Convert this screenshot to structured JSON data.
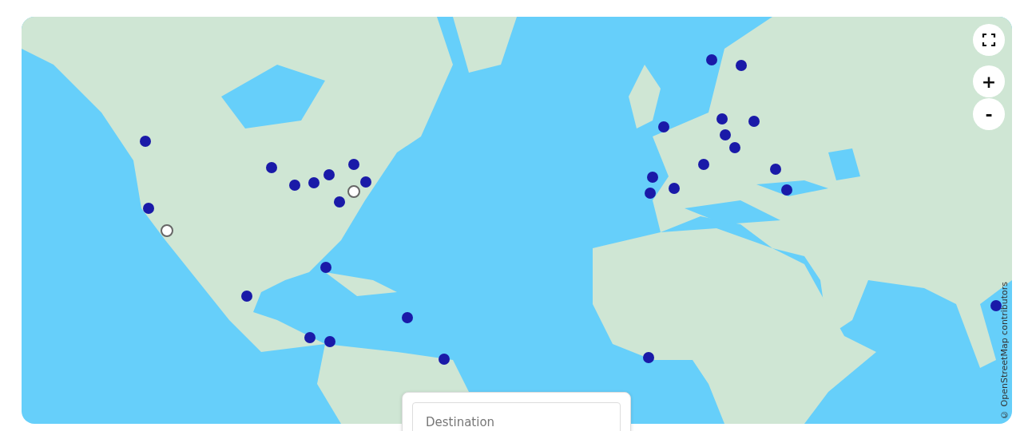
{
  "map": {
    "attribution": "© OpenStreetMap contributors",
    "controls": {
      "zoom_in": "+",
      "zoom_out": "-"
    },
    "markers": [
      {
        "selected": false
      },
      {
        "selected": false
      },
      {
        "selected": true
      },
      {
        "selected": false
      },
      {
        "selected": false
      },
      {
        "selected": false
      },
      {
        "selected": false
      },
      {
        "selected": false
      },
      {
        "selected": false
      },
      {
        "selected": true
      },
      {
        "selected": false
      },
      {
        "selected": false
      },
      {
        "selected": false
      },
      {
        "selected": false
      },
      {
        "selected": false
      },
      {
        "selected": false
      },
      {
        "selected": false
      },
      {
        "selected": false
      },
      {
        "selected": false
      },
      {
        "selected": false
      },
      {
        "selected": false
      },
      {
        "selected": false
      },
      {
        "selected": false
      },
      {
        "selected": false
      },
      {
        "selected": false
      },
      {
        "selected": false
      },
      {
        "selected": false
      },
      {
        "selected": false
      },
      {
        "selected": false
      },
      {
        "selected": false
      },
      {
        "selected": false
      },
      {
        "selected": false
      }
    ]
  },
  "search_card": {
    "destination": {
      "placeholder": "Destination"
    }
  }
}
